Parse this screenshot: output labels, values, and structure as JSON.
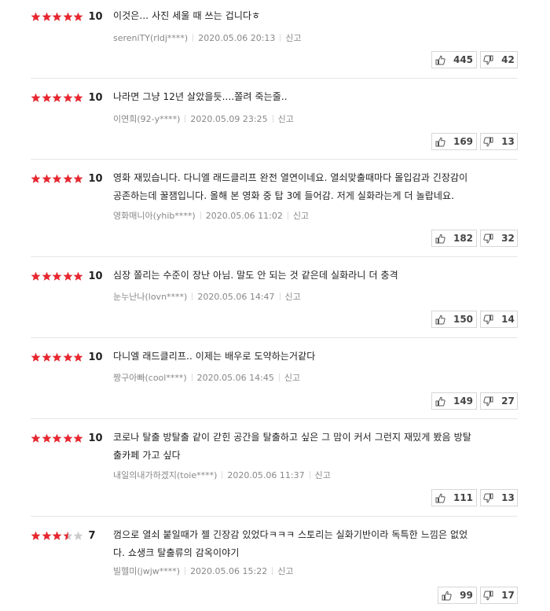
{
  "reviews": [
    {
      "rating": 5,
      "score": "10",
      "text_lines": [
        "이것은... 사진 세울 때 쓰는 겁니다ㅎ"
      ],
      "author": "sereniTY(rldj****)",
      "date": "2020.05.06 20:13",
      "report": "신고",
      "likes": "445",
      "dislikes": "42"
    },
    {
      "rating": 5,
      "score": "10",
      "text_lines": [
        "나라면 그냥 12년 살았을듯....쫄려 죽는줄.."
      ],
      "author": "이연희(92-y****)",
      "date": "2020.05.09 23:25",
      "report": "신고",
      "likes": "169",
      "dislikes": "13"
    },
    {
      "rating": 5,
      "score": "10",
      "text_lines": [
        "영화 재밌습니다. 다니엘 래드클리프 완전 열연이네요. 열쇠맞출때마다 몰입감과 긴장감이",
        "공존하는데 꿀잼입니다. 올해 본 영화 중 탑 3에 들어감. 저게 실화라는게 더 놀랍네요."
      ],
      "author": "영화매니아(yhib****)",
      "date": "2020.05.06 11:02",
      "report": "신고",
      "likes": "182",
      "dislikes": "32"
    },
    {
      "rating": 5,
      "score": "10",
      "text_lines": [
        "심장 쫄리는 수준이 장난 아님. 말도 안 되는 것 같은데 실화라니 더 충격"
      ],
      "author": "눈누난나(lovn****)",
      "date": "2020.05.06 14:47",
      "report": "신고",
      "likes": "150",
      "dislikes": "14"
    },
    {
      "rating": 5,
      "score": "10",
      "text_lines": [
        "다니엘 래드클리프.. 이제는 배우로 도약하는거같다"
      ],
      "author": "짱구아빠(cool****)",
      "date": "2020.05.06 14:45",
      "report": "신고",
      "likes": "149",
      "dislikes": "27"
    },
    {
      "rating": 5,
      "score": "10",
      "text_lines": [
        "코로나 탈출 방탈출 같이 갇힌 공간을 탈출하고 싶은 그 맘이 커서 그런지 재밌게 봤음 방탈",
        "출카페 가고 싶다"
      ],
      "author": "내일의내가하겠지(toie****)",
      "date": "2020.05.06 11:37",
      "report": "신고",
      "likes": "111",
      "dislikes": "13"
    },
    {
      "rating": 3.5,
      "score": "7",
      "text_lines": [
        "껌으로 열쇠 붙일때가 젤 긴장감 있었다ㅋㅋㅋ 스토리는 실화기반이라 독특한 느낌은 없었",
        "다. 쇼생크 탈출류의 감옥이야기"
      ],
      "author": "빌헬미(jwjw****)",
      "date": "2020.05.06 15:22",
      "report": "신고",
      "likes": "99",
      "dislikes": "17"
    }
  ],
  "colors": {
    "star_on": "#e8262f",
    "star_off": "#cccccc"
  }
}
